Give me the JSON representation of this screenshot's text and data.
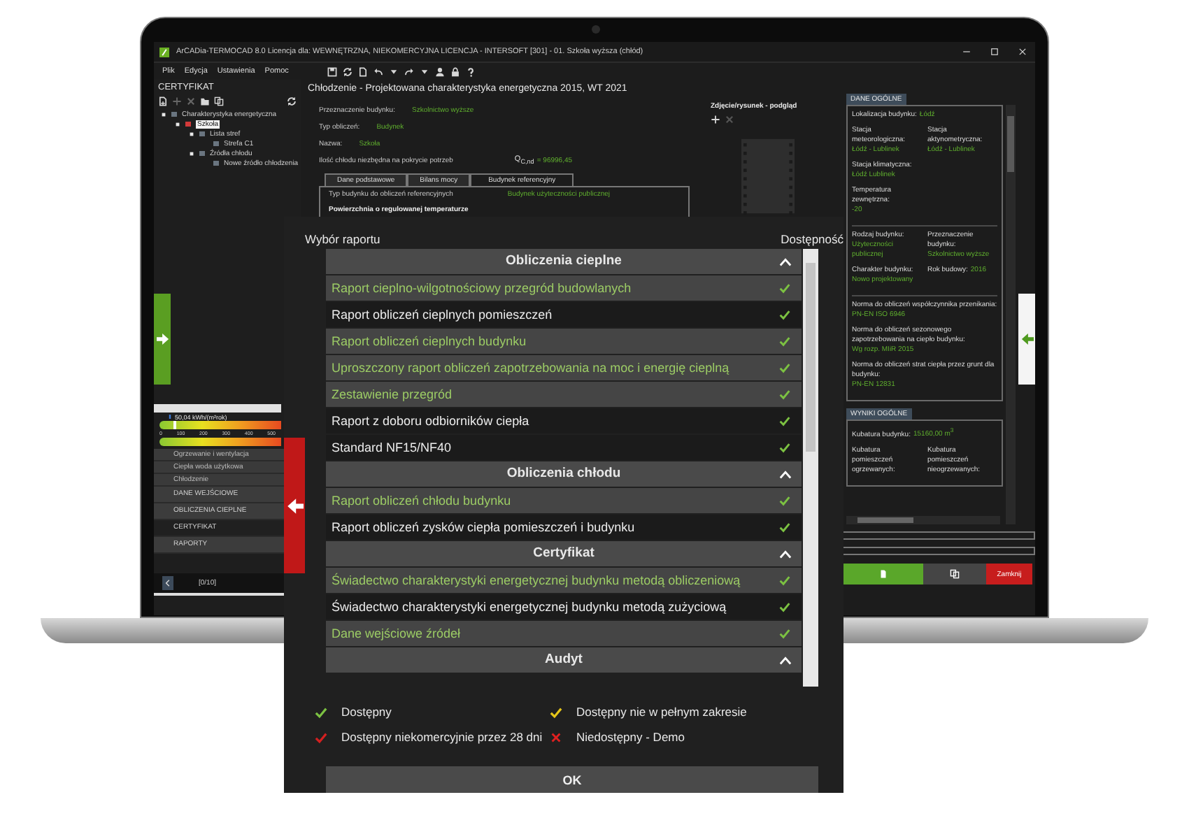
{
  "app_window": {
    "title": "ArCADia-TERMOCAD 8.0 Licencja dla: WEWNĘTRZNA, NIEKOMERCYJNA LICENCJA - INTERSOFT [301] - 01. Szkoła wyższa (chłód)",
    "menu": [
      "Plik",
      "Edycja",
      "Ustawienia",
      "Pomoc"
    ]
  },
  "left_panel": {
    "title": "CERTYFIKAT",
    "tree": [
      {
        "label": "Charakterystyka energetyczna",
        "selected": false,
        "children": [
          {
            "label": "Szkoła",
            "selected": true,
            "children": [
              {
                "label": "Lista stref",
                "selected": false,
                "children": [
                  {
                    "label": "Strefa C1",
                    "selected": false
                  }
                ]
              },
              {
                "label": "Źródła chłodu",
                "selected": false,
                "children": [
                  {
                    "label": "Nowe źródło chłodzenia",
                    "selected": false
                  }
                ]
              }
            ]
          }
        ]
      }
    ],
    "energy_meter": {
      "reading": "50,04 kWh/(m²rok)",
      "level": 0.12,
      "ticks": [
        "0",
        "100",
        "200",
        "300",
        "400",
        "500"
      ]
    },
    "categories": [
      "Ogrzewanie i wentylacja",
      "Ciepła woda użytkowa",
      "Chłodzenie"
    ],
    "nav": [
      {
        "label": "DANE WEJŚCIOWE",
        "selected": false
      },
      {
        "label": "OBLICZENIA CIEPLNE",
        "selected": false
      },
      {
        "label": "CERTYFIKAT",
        "selected": true
      },
      {
        "label": "RAPORTY",
        "selected": false
      }
    ],
    "pager": "[0/10]"
  },
  "main": {
    "title": "Chłodzenie - Projektowana charakterystyka energetyczna 2015, WT 2021",
    "fields": [
      {
        "label": "Przeznaczenie budynku:",
        "value": "Szkolnictwo wyższe"
      },
      {
        "label": "Typ obliczeń:",
        "value": "Budynek"
      },
      {
        "label": "Nazwa:",
        "value": "Szkoła"
      }
    ],
    "demand": {
      "label": "Ilość chłodu niezbędna na pokrycie potrzeb",
      "symbol": "Q$_{C,nd}$",
      "value": "= 96996,45"
    },
    "tabs": [
      {
        "label": "Dane podstawowe",
        "selected": false
      },
      {
        "label": "Bilans mocy",
        "selected": false
      },
      {
        "label": "Budynek referencyjny",
        "selected": true
      }
    ],
    "tab_rows": [
      {
        "label": "Typ budynku do obliczeń referencyjnych",
        "value": "Budynek użyteczności publicznej"
      }
    ],
    "section_heading": "Powierzchnia o regulowanej temperaturze",
    "preview": {
      "title": "Zdjęcie/rysunek - podgląd"
    }
  },
  "right_panel": {
    "general": {
      "title": "DANE OGÓLNE",
      "sections": [
        [
          {
            "kind": "full",
            "fields": [
              {
                "label": "Lokalizacja budynku:",
                "value": "Łódź"
              }
            ]
          },
          {
            "kind": "pair",
            "fields": [
              {
                "label": "Stacja meteorologiczna:",
                "value": "Łódź - Lublinek"
              },
              {
                "label": "Stacja aktynometryczna:",
                "value": "Łódź - Lublinek"
              }
            ]
          },
          {
            "kind": "pair",
            "fields": [
              {
                "label": "Stacja klimatyczna:",
                "value": "Łódź Lublinek"
              }
            ]
          },
          {
            "kind": "pair",
            "fields": [
              {
                "label": "Temperatura zewnętrzna:",
                "value": "-20"
              }
            ]
          }
        ],
        [
          {
            "kind": "pair",
            "fields": [
              {
                "label": "Rodzaj budynku:",
                "value": "Użyteczności publicznej"
              },
              {
                "label": "Przeznaczenie budynku:",
                "value": "Szkolnictwo wyższe"
              }
            ]
          },
          {
            "kind": "pair",
            "fields": [
              {
                "label": "Charakter budynku:",
                "value": "Nowo projektowany"
              },
              {
                "label": "Rok budowy:",
                "value": "2016"
              }
            ]
          }
        ],
        [
          {
            "kind": "full",
            "fields": [
              {
                "label": "Norma do obliczeń współczynnika przenikania:",
                "value": "PN-EN ISO 6946"
              }
            ]
          },
          {
            "kind": "full",
            "fields": [
              {
                "label": "Norma do obliczeń sezonowego zapotrzebowania na ciepło budynku:",
                "value": "Wg rozp. MIiR 2015"
              }
            ]
          },
          {
            "kind": "full",
            "fields": [
              {
                "label": "Norma do obliczeń strat ciepła przez grunt dla budynku:",
                "value": "PN-EN 12831"
              }
            ]
          }
        ]
      ]
    },
    "results": {
      "title": "WYNIKI OGÓLNE",
      "rows": [
        {
          "kind": "full",
          "fields": [
            {
              "label": "Kubatura budynku:",
              "value": "15160,00 m$^{3}$"
            }
          ]
        },
        {
          "kind": "pair",
          "fields": [
            {
              "label": "Kubatura pomieszczeń ogrzewanych:"
            },
            {
              "label": "Kubatura pomieszczeń nieogrzewanych:"
            }
          ]
        }
      ]
    },
    "close_label": "Zamknij"
  },
  "report_dialog": {
    "title": "Wybór raportu",
    "availability_label": "Dostępność",
    "groups": [
      {
        "title": "Obliczenia cieplne",
        "expanded": true,
        "reports": [
          {
            "name": "Raport cieplno-wilgotnościowy przegród budowlanych",
            "selected": true,
            "kind": "available"
          },
          {
            "name": "Raport obliczeń cieplnych pomieszczeń",
            "selected": false,
            "kind": "available"
          },
          {
            "name": "Raport obliczeń cieplnych budynku",
            "selected": true,
            "kind": "available"
          },
          {
            "name": "Uproszczony raport obliczeń zapotrzebowania na moc i energię cieplną",
            "selected": true,
            "kind": "available"
          },
          {
            "name": "Zestawienie przegród",
            "selected": true,
            "kind": "available"
          },
          {
            "name": "Raport z doboru odbiorników ciepła",
            "selected": false,
            "kind": "available"
          },
          {
            "name": "Standard NF15/NF40",
            "selected": false,
            "kind": "available"
          }
        ]
      },
      {
        "title": "Obliczenia chłodu",
        "expanded": true,
        "reports": [
          {
            "name": "Raport obliczeń chłodu budynku",
            "selected": true,
            "kind": "available"
          },
          {
            "name": "Raport obliczeń zysków ciepła pomieszczeń i budynku",
            "selected": false,
            "kind": "available"
          }
        ]
      },
      {
        "title": "Certyfikat",
        "expanded": true,
        "reports": [
          {
            "name": "Świadectwo charakterystyki energetycznej budynku metodą obliczeniową",
            "selected": true,
            "kind": "available"
          },
          {
            "name": "Świadectwo charakterystyki energetycznej budynku metodą zużyciową",
            "selected": false,
            "kind": "available"
          },
          {
            "name": "Dane wejściowe źródeł",
            "selected": true,
            "kind": "available"
          }
        ]
      },
      {
        "title": "Audyt",
        "expanded": true
      }
    ],
    "legend": [
      {
        "kind": "available",
        "label": "Dostępny"
      },
      {
        "kind": "partial",
        "label": "Dostępny nie w pełnym zakresie"
      },
      {
        "kind": "noncommercial",
        "label": "Dostępny niekomercyjnie przez 28 dni"
      },
      {
        "kind": "demo",
        "label": "Niedostępny - Demo"
      }
    ],
    "ok_label": "OK"
  }
}
